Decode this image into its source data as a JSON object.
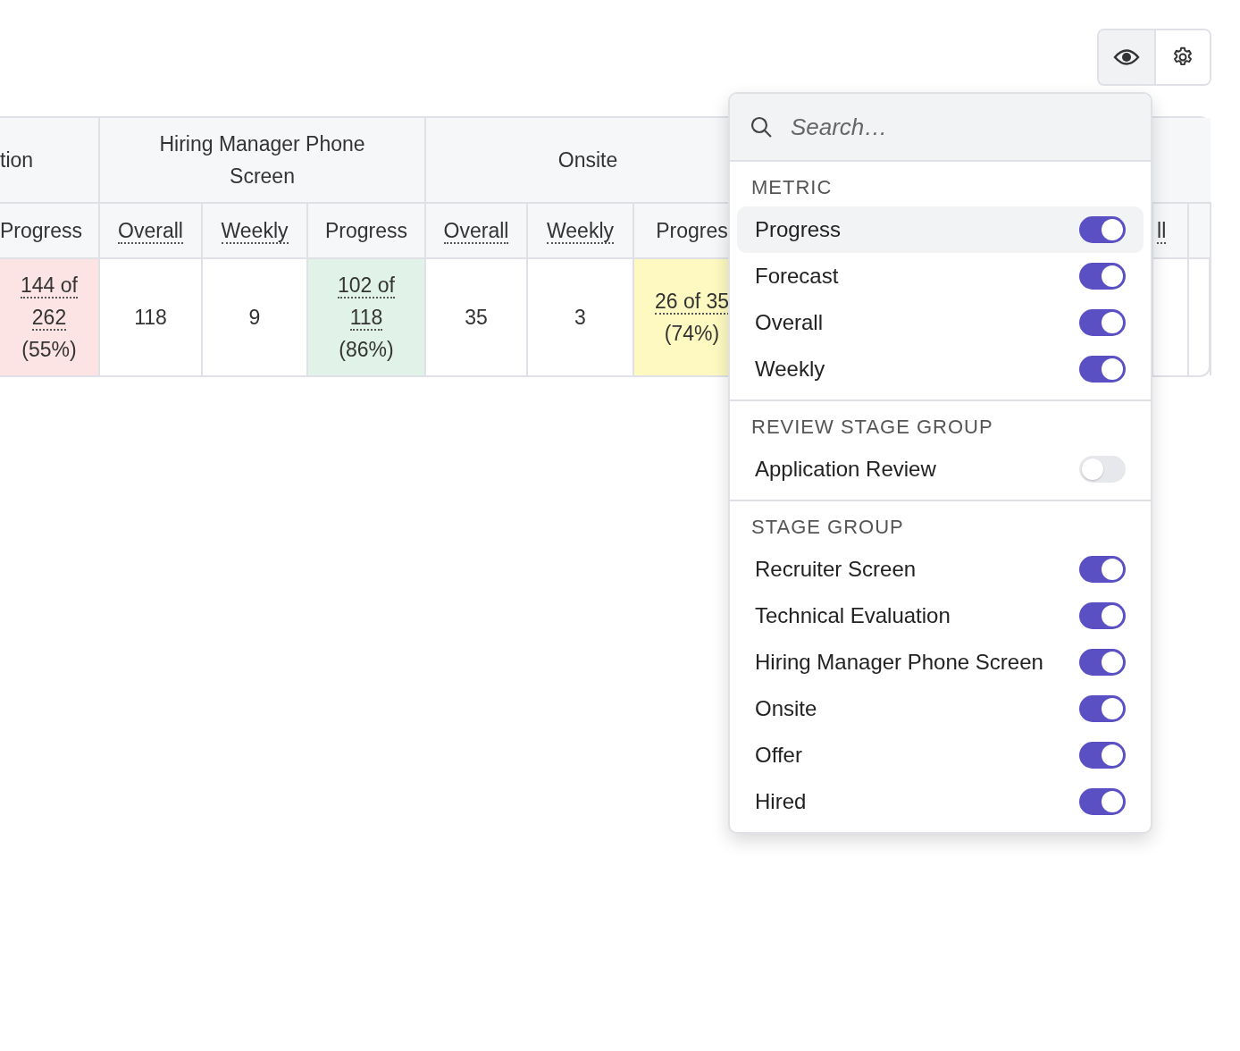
{
  "toolbar": {
    "buttons": [
      {
        "kind": "eye",
        "selected": true
      },
      {
        "kind": "gear",
        "selected": false
      }
    ]
  },
  "table": {
    "groups": [
      {
        "label": "tion",
        "columns": [
          {
            "label": "Progress",
            "kind": "progress",
            "underlined": false,
            "cell": {
              "value": "144 of 262",
              "percent": "(55%)",
              "color": "#fce4e4"
            }
          }
        ]
      },
      {
        "label": "Hiring Manager Phone Screen",
        "columns": [
          {
            "label": "Overall",
            "kind": "count",
            "underlined": true,
            "cell": {
              "value": "118"
            }
          },
          {
            "label": "Weekly",
            "kind": "count",
            "underlined": true,
            "cell": {
              "value": "9"
            }
          },
          {
            "label": "Progress",
            "kind": "progress",
            "underlined": false,
            "cell": {
              "value": "102 of 118",
              "percent": "(86%)",
              "color": "#e1f3e8"
            }
          }
        ]
      },
      {
        "label": "Onsite",
        "columns": [
          {
            "label": "Overall",
            "kind": "count",
            "underlined": true,
            "cell": {
              "value": "35"
            }
          },
          {
            "label": "Weekly",
            "kind": "count",
            "underlined": true,
            "cell": {
              "value": "3"
            }
          },
          {
            "label": "Progres",
            "kind": "progress",
            "underlined": false,
            "cell": {
              "value": "26 of 35",
              "percent": "(74%)",
              "color": "#fdf9c0"
            }
          }
        ]
      }
    ],
    "trailing_columns": [
      {
        "label": "ll",
        "underlined": true
      }
    ]
  },
  "menu": {
    "search": {
      "placeholder": "Search…"
    },
    "sections": [
      {
        "title": "METRIC",
        "items": [
          {
            "label": "Progress",
            "on": true,
            "selected": true
          },
          {
            "label": "Forecast",
            "on": true,
            "selected": false
          },
          {
            "label": "Overall",
            "on": true,
            "selected": false
          },
          {
            "label": "Weekly",
            "on": true,
            "selected": false
          }
        ]
      },
      {
        "title": "REVIEW STAGE GROUP",
        "items": [
          {
            "label": "Application Review",
            "on": false,
            "selected": false
          }
        ]
      },
      {
        "title": "STAGE GROUP",
        "items": [
          {
            "label": "Recruiter Screen",
            "on": true,
            "selected": false
          },
          {
            "label": "Technical Evaluation",
            "on": true,
            "selected": false
          },
          {
            "label": "Hiring Manager Phone Screen",
            "on": true,
            "selected": false
          },
          {
            "label": "Onsite",
            "on": true,
            "selected": false
          },
          {
            "label": "Offer",
            "on": true,
            "selected": false
          },
          {
            "label": "Hired",
            "on": true,
            "selected": false
          }
        ]
      }
    ]
  }
}
